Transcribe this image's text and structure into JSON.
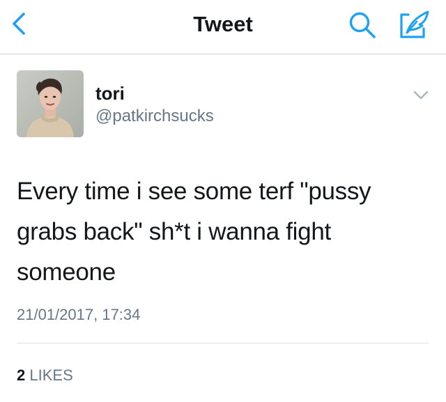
{
  "nav": {
    "title": "Tweet",
    "back_icon": "chevron-left-icon",
    "search_icon": "search-icon",
    "compose_icon": "compose-tweet-icon",
    "accent_color": "#1da1f2"
  },
  "tweet": {
    "author": {
      "name": "tori",
      "handle": "@patkirchsucks"
    },
    "text_lines": [
      "Every time i see some terf \"pussy",
      "grabs back\" sh*t i wanna fight",
      "someone"
    ],
    "timestamp": "21/01/2017, 17:34",
    "likes": {
      "count": "2",
      "label": "LIKES"
    }
  }
}
